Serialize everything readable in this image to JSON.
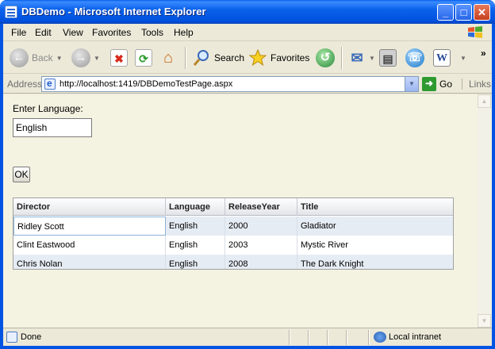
{
  "window": {
    "title": "DBDemo - Microsoft Internet Explorer",
    "min_glyph": "_",
    "max_glyph": "□",
    "close_glyph": "✕"
  },
  "menu": {
    "items": [
      "File",
      "Edit",
      "View",
      "Favorites",
      "Tools",
      "Help"
    ]
  },
  "toolbar": {
    "back_label": "Back",
    "search_label": "Search",
    "favorites_label": "Favorites",
    "more_glyph": "»"
  },
  "address": {
    "label": "Address",
    "url": "http://localhost:1419/DBDemoTestPage.aspx",
    "go_label": "Go",
    "links_label": "Links"
  },
  "page": {
    "language_label": "Enter Language:",
    "language_value": "English",
    "ok_label": "OK"
  },
  "grid": {
    "columns": [
      "Director",
      "Language",
      "ReleaseYear",
      "Title"
    ],
    "rows": [
      [
        "Ridley Scott",
        "English",
        "2000",
        "Gladiator"
      ],
      [
        "Clint Eastwood",
        "English",
        "2003",
        "Mystic River"
      ],
      [
        "Chris Nolan",
        "English",
        "2008",
        "The Dark Knight"
      ]
    ]
  },
  "status": {
    "text": "Done",
    "zone": "Local intranet"
  },
  "colors": {
    "titlebar": "#0054e3",
    "chrome": "#ece9d8",
    "content_bg": "#f4f3e2",
    "grid_alt_row": "#e6ecf4"
  }
}
